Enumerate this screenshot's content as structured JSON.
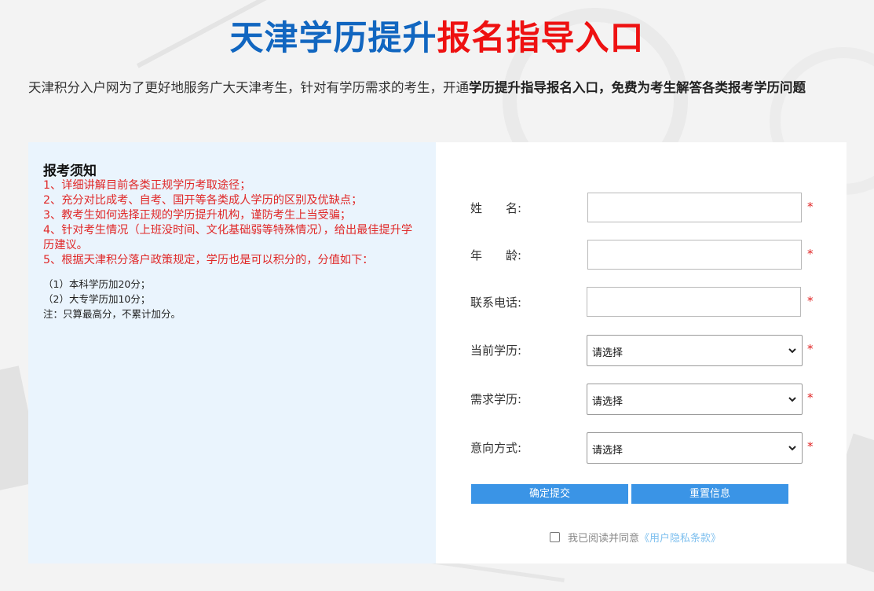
{
  "header": {
    "title_part1": "天津学历提升",
    "title_part2": "报名指导入口"
  },
  "intro": {
    "text_regular": "天津积分入户网为了更好地服务广大天津考生，针对有学历需求的考生，开通",
    "text_bold": "学历提升指导报名入口，免费为考生解答各类报考学历问题"
  },
  "notice": {
    "title": "报考须知",
    "items": [
      "1、详细讲解目前各类正规学历考取途径；",
      "2、充分对比成考、自考、国开等各类成人学历的区别及优缺点；",
      "3、教考生如何选择正规的学历提升机构，谨防考生上当受骗；",
      "4、针对考生情况（上班没时间、文化基础弱等特殊情况），给出最佳提升学历建议。",
      "5、根据天津积分落户政策规定，学历也是可以积分的，分值如下："
    ],
    "sub_items": [
      "（1）本科学历加20分；",
      "（2）大专学历加10分；",
      "注：只算最高分，不累计加分。"
    ]
  },
  "form": {
    "name_label": "姓　　名:",
    "age_label": "年　　龄:",
    "phone_label": "联系电话:",
    "current_edu_label": "当前学历:",
    "target_edu_label": "需求学历:",
    "method_label": "意向方式:",
    "name_value": "",
    "age_value": "",
    "phone_value": "",
    "current_edu_selected": "请选择",
    "target_edu_selected": "请选择",
    "method_selected": "请选择",
    "required_mark": "*",
    "submit_label": "确定提交",
    "reset_label": "重置信息",
    "agree_text": "我已阅读并同意",
    "agree_link": "《用户隐私条款》"
  },
  "colors": {
    "title_blue": "#1166c0",
    "title_red": "#ee1111",
    "notice_red": "#e02828",
    "button_blue": "#3a94e6",
    "left_panel_bg": "#eaf4fd"
  }
}
